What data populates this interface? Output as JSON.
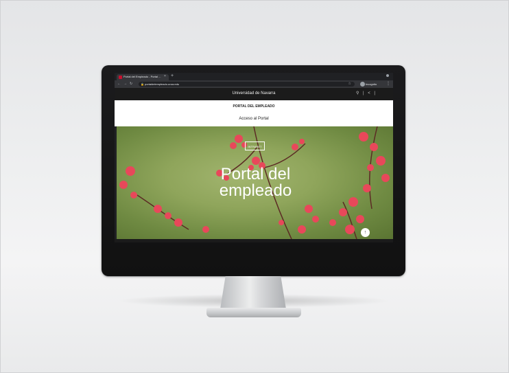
{
  "browser": {
    "tab_title": "Portal del Empleado - Portal ...",
    "tab_close": "×",
    "new_tab": "+",
    "url": "portaldelempleado.unav.edu",
    "profile_label": "Incognito"
  },
  "site": {
    "header_title": "Universidad de Navarra",
    "header_icons": "⚲ | < |",
    "subnav_title": "PORTAL DEL EMPLEADO",
    "subnav_link": "Acceso al Portal"
  },
  "hero": {
    "badge": "INTRANET",
    "title": "Portal del empleado",
    "scroll_icon": "↑"
  },
  "colors": {
    "brand": "#c8102e",
    "hero_green": "#8fa55b",
    "flower_red": "#e8485a"
  }
}
